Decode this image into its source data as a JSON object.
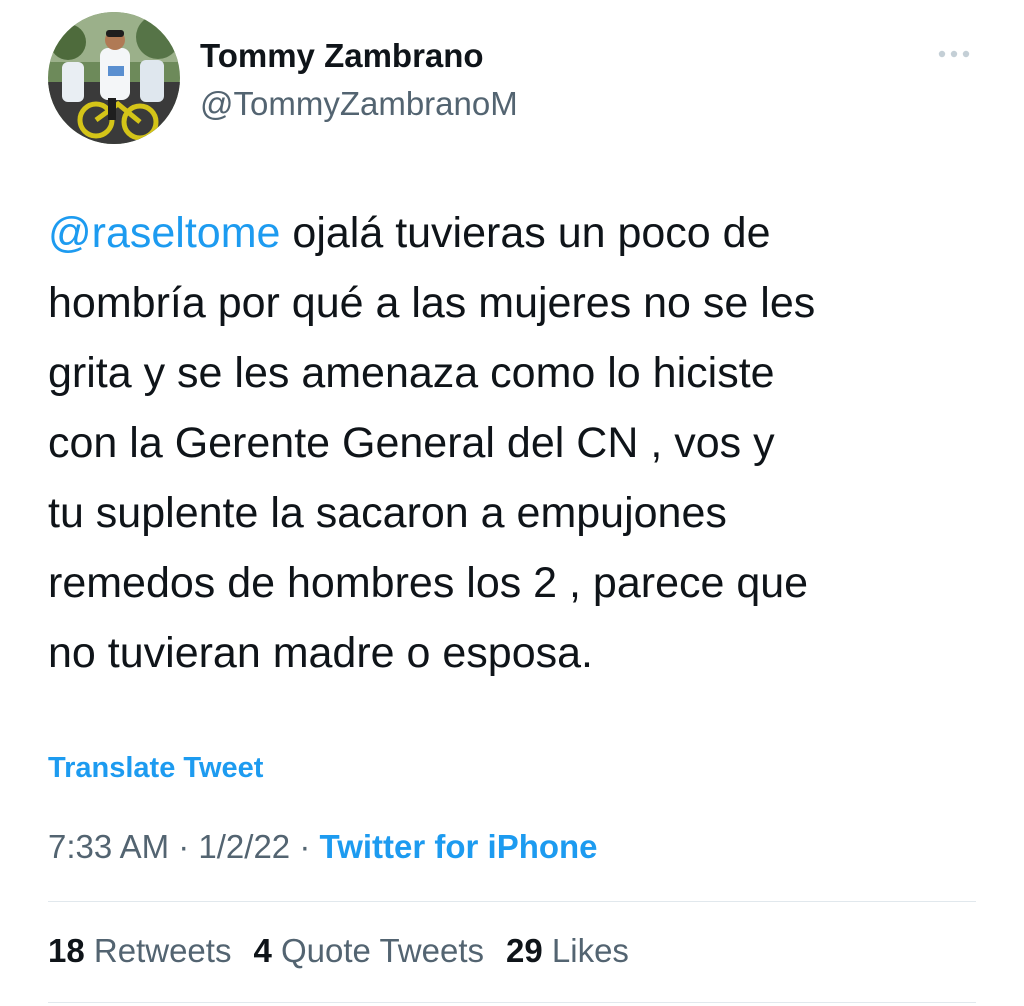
{
  "author": {
    "display_name": "Tommy Zambrano",
    "handle": "@TommyZambranoM"
  },
  "more_icon": "ellipsis-icon",
  "tweet": {
    "mention": "@raseltome",
    "text_after_mention": " ojalá tuvieras un poco de\nhombría por qué a las mujeres no se les\ngrita y se les amenaza  como lo hiciste\ncon la Gerente General del CN , vos y\ntu suplente la sacaron a empujones\nremedos de hombres los 2 , parece que\nno tuvieran madre o esposa.",
    "translate_label": "Translate Tweet"
  },
  "meta": {
    "time": "7:33 AM",
    "separator": " · ",
    "date": "1/2/22",
    "source": "Twitter for iPhone"
  },
  "stats": {
    "retweets_count": "18",
    "retweets_label": " Retweets",
    "quotes_count": "4",
    "quotes_label": " Quote Tweets",
    "likes_count": "29",
    "likes_label": " Likes"
  },
  "colors": {
    "link": "#1d9bf0",
    "secondary_text": "#536471",
    "primary_text": "#0f1419",
    "divider": "#e1e8ed"
  }
}
